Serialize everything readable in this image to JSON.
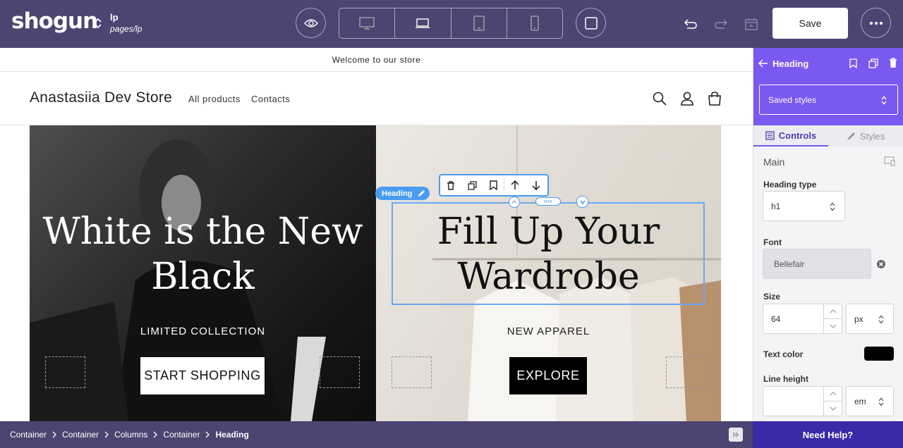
{
  "app": {
    "logo": "shogun",
    "page_name": "lp",
    "page_path": "pages/lp",
    "save_label": "Save"
  },
  "store": {
    "announcement": "Welcome to our store",
    "name": "Anastasiia Dev Store",
    "nav": [
      "All products",
      "Contacts"
    ]
  },
  "hero_left": {
    "title": "White is the New Black",
    "subtitle": "LIMITED COLLECTION",
    "button": "START SHOPPING"
  },
  "hero_right": {
    "title": "Fill Up Your Wardrobe",
    "subtitle": "NEW APPAREL",
    "button": "EXPLORE"
  },
  "selection": {
    "badge": "Heading"
  },
  "panel": {
    "title": "Heading",
    "saved_styles": "Saved styles",
    "tabs": [
      "Controls",
      "Styles"
    ],
    "section": "Main",
    "heading_type_label": "Heading type",
    "heading_type_value": "h1",
    "font_label": "Font",
    "font_value": "Bellefair",
    "size_label": "Size",
    "size_value": "64",
    "size_unit": "px",
    "text_color_label": "Text color",
    "text_color_value": "#000000",
    "line_height_label": "Line height",
    "line_height_value": "",
    "line_height_unit": "em"
  },
  "breadcrumb": [
    "Container",
    "Container",
    "Columns",
    "Container",
    "Heading"
  ],
  "help": "Need Help?",
  "colors": {
    "topbar": "#4c4571",
    "accent": "#7a59f0",
    "selection": "#4a9cf0"
  }
}
